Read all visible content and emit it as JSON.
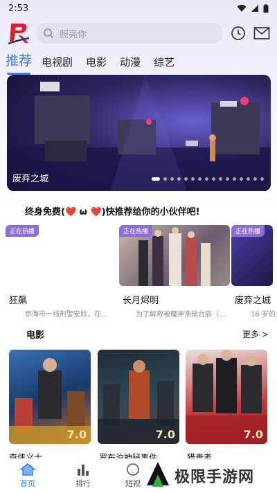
{
  "status": {
    "time": "2:53"
  },
  "header": {
    "search_placeholder": "照亮你"
  },
  "tabs": [
    {
      "label": "推荐",
      "active": true
    },
    {
      "label": "电视剧",
      "active": false
    },
    {
      "label": "电影",
      "active": false
    },
    {
      "label": "动漫",
      "active": false
    },
    {
      "label": "综艺",
      "active": false
    }
  ],
  "banner": {
    "title": "废弃之城"
  },
  "invite_text": "终身免费(❤️ ω ❤️)快推荐给你的小伙伴吧!",
  "hot": [
    {
      "badge": "正在热播",
      "name": "狂飙",
      "desc": "京海市一线刑警安欣，在..."
    },
    {
      "badge": "正在热播",
      "name": "长月烬明",
      "desc": "为了解救被魔神浩劫台辰（..."
    },
    {
      "badge": "正在热播",
      "name": "废弃之城",
      "desc": "16 岁的..."
    }
  ],
  "movies_section": {
    "title": "电影",
    "more": "更多 >"
  },
  "movies": [
    {
      "name": "奇侠义士",
      "score": "7.0"
    },
    {
      "name": "罗布泊神秘事件",
      "score": "7.0"
    },
    {
      "name": "猎毒者",
      "score": "7.0"
    }
  ],
  "bottom_nav": [
    {
      "label": "首页",
      "active": true
    },
    {
      "label": "排行",
      "active": false
    },
    {
      "label": "短视",
      "active": false
    }
  ],
  "watermark": "极限手游网",
  "colors": {
    "accent": "#3b7de0",
    "badge": "#8b6fd6"
  }
}
